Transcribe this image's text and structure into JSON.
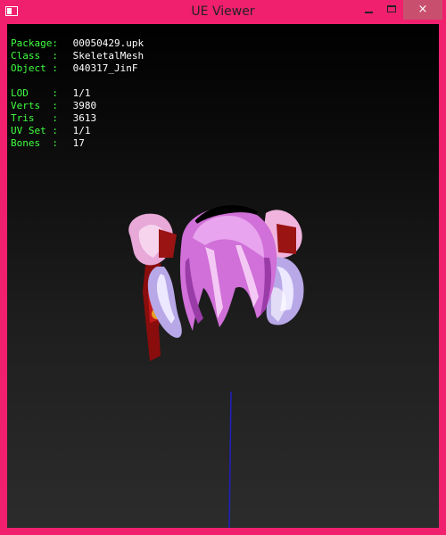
{
  "window": {
    "title": "UE Viewer",
    "controls": {
      "minimize": "minimize",
      "maximize": "maximize",
      "close": "×"
    }
  },
  "info": {
    "package_label": "Package:",
    "package": "00050429.upk",
    "class_label": "Class  :",
    "class": "SkeletalMesh",
    "object_label": "Object :",
    "object": "040317_JinF",
    "lod_label": "LOD    :",
    "lod": "1/1",
    "verts_label": "Verts  :",
    "verts": "3980",
    "tris_label": "Tris   :",
    "tris": "3613",
    "uvset_label": "UV Set :",
    "uvset": "1/1",
    "bones_label": "Bones  :",
    "bones": "17"
  },
  "colors": {
    "frame": "#f0206e",
    "label_green": "#40ff40",
    "value_white": "#ffffff",
    "axis_blue": "#2020c0"
  }
}
